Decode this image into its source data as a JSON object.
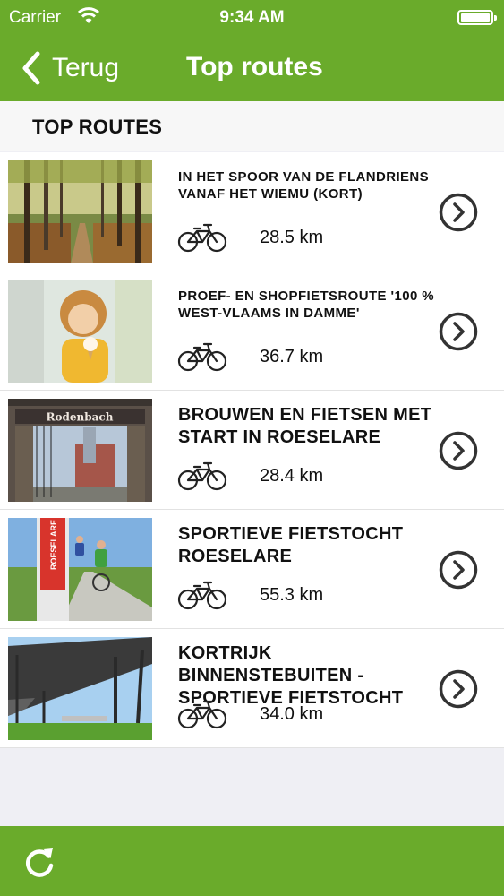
{
  "status_bar": {
    "carrier": "Carrier",
    "time": "9:34 AM"
  },
  "nav": {
    "back_label": "Terug",
    "title": "Top routes"
  },
  "section": {
    "title": "TOP ROUTES"
  },
  "routes": [
    {
      "title": "IN HET SPOOR VAN DE FLANDRIENS VANAF HET WIEMU (KORT)",
      "distance": "28.5 km",
      "image": "forest-path"
    },
    {
      "title": "PROEF- EN SHOPFIETSROUTE '100 % WEST-VLAAMS IN DAMME'",
      "distance": "36.7 km",
      "image": "child-ice-cream"
    },
    {
      "title": "BROUWEN EN FIETSEN MET START IN ROESELARE",
      "distance": "28.4 km",
      "image": "brewery-gate",
      "sign": "Rodenbach"
    },
    {
      "title": "SPORTIEVE FIETSTOCHT ROESELARE",
      "distance": "55.3 km",
      "image": "cyclists-signpost",
      "sign": "ROESELARE"
    },
    {
      "title": "KORTRIJK BINNENSTEBUITEN - SPORTIEVE FIETSTOCHT",
      "distance": "34.0 km",
      "image": "bridge-park"
    }
  ],
  "colors": {
    "brand_green": "#6aab2b",
    "background": "#efeff4",
    "text": "#111111"
  },
  "icons": {
    "back": "chevron-left-icon",
    "bike": "bicycle-icon",
    "go": "chevron-right-circle-icon",
    "refresh": "refresh-icon",
    "wifi": "wifi-icon",
    "battery": "battery-icon"
  }
}
